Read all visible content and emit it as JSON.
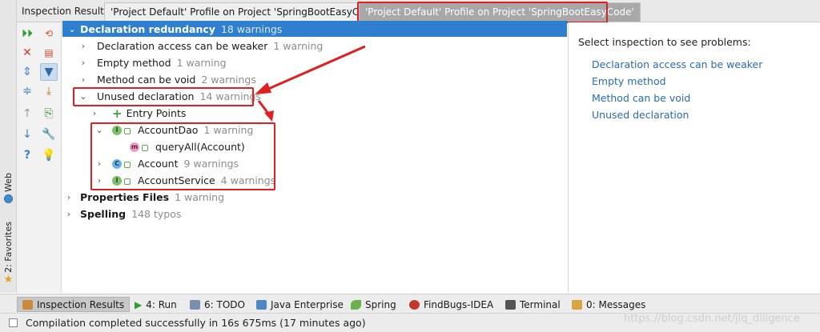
{
  "left_strip": {
    "web_label": "Web",
    "favorites_label": "2: Favorites"
  },
  "header": {
    "label": "Inspection Results:",
    "tabs": [
      {
        "label": "'Project Default' Profile on Project 'SpringBootEasyCode'"
      },
      {
        "label": "'Project Default' Profile on Project 'SpringBootEasyCode'"
      }
    ]
  },
  "toolbar": {
    "icons": [
      "run-icon",
      "rerun-icon",
      "close-icon",
      "filter-icon",
      "expand-all-icon",
      "export-icon",
      "collapse-all-icon",
      "edit-settings-icon",
      "prev-icon",
      "next-icon",
      "help-icon",
      "bulb-icon"
    ]
  },
  "tree": {
    "root": {
      "label": "Declaration redundancy",
      "count": "18 warnings"
    },
    "items": [
      {
        "label": "Declaration access can be weaker",
        "count": "1 warning"
      },
      {
        "label": "Empty method",
        "count": "1 warning"
      },
      {
        "label": "Method can be void",
        "count": "2 warnings"
      },
      {
        "label": "Unused declaration",
        "count": "14 warnings"
      }
    ],
    "entry_points": "Entry Points",
    "classes": [
      {
        "name": "AccountDao",
        "count": "1 warning",
        "kind": "I"
      },
      {
        "name": "queryAll(Account)",
        "count": "",
        "kind": "m"
      },
      {
        "name": "Account",
        "count": "9 warnings",
        "kind": "C"
      },
      {
        "name": "AccountService",
        "count": "4 warnings",
        "kind": "I"
      }
    ],
    "groups": [
      {
        "label": "Properties Files",
        "count": "1 warning"
      },
      {
        "label": "Spelling",
        "count": "148 typos"
      }
    ]
  },
  "right_panel": {
    "hint": "Select inspection to see problems:",
    "links": [
      "Declaration access can be weaker",
      "Empty method",
      "Method can be void",
      "Unused declaration"
    ]
  },
  "bottom_tools": [
    {
      "label": "Inspection Results",
      "active": true
    },
    {
      "label": "4: Run"
    },
    {
      "label": "6: TODO"
    },
    {
      "label": "Java Enterprise"
    },
    {
      "label": "Spring"
    },
    {
      "label": "FindBugs-IDEA"
    },
    {
      "label": "Terminal"
    },
    {
      "label": "0: Messages"
    }
  ],
  "status": {
    "message": "Compilation completed successfully in 16s 675ms (17 minutes ago)",
    "watermark": "https://blog.csdn.net/jlq_diligence"
  },
  "colors": {
    "selection": "#2e7fce",
    "annotation": "#e02020",
    "link": "#2a6bb0"
  }
}
